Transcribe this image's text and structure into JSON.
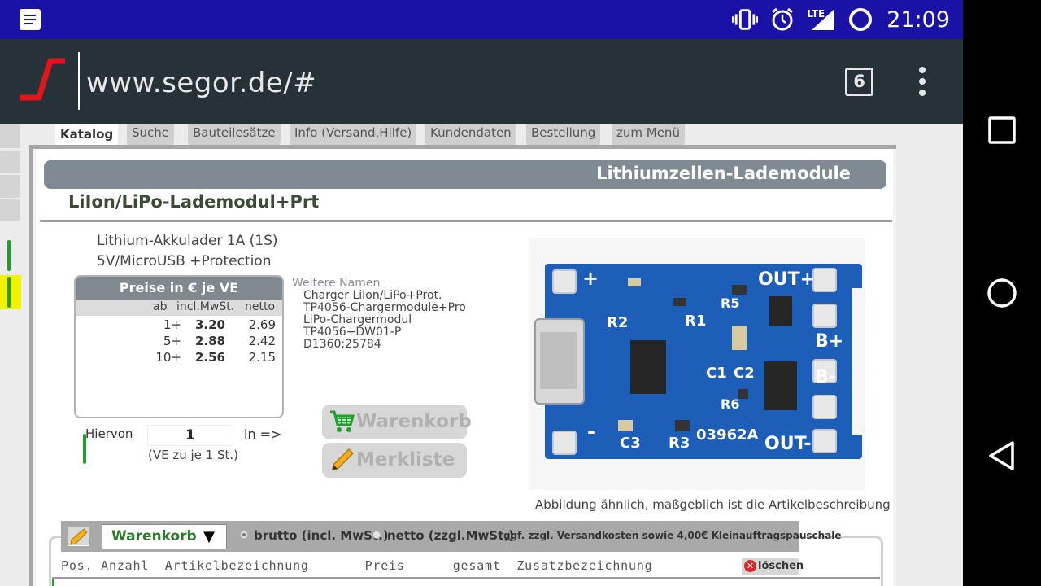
{
  "status_bar": {
    "time": "21:09",
    "network": "LTE"
  },
  "browser": {
    "url": "www.segor.de/#",
    "tab_count": "6"
  },
  "nav_tabs": [
    {
      "label": "Katalog",
      "active": true
    },
    {
      "label": "Suche"
    },
    {
      "label": "Bauteilesätze"
    },
    {
      "label": "Info (Versand,Hilfe)"
    },
    {
      "label": "Kundendaten"
    },
    {
      "label": "Bestellung"
    },
    {
      "label": "zum Menü"
    }
  ],
  "category": "Lithiumzellen-Lademodule",
  "product": {
    "title": "LiIon/LiPo-Lademodul+Prt",
    "desc_line1": "Lithium-Akkulader 1A (1S)",
    "desc_line2": "5V/MicroUSB +Protection"
  },
  "prices": {
    "header": "Preise in € je VE",
    "col_ab": "ab",
    "col_incl": "incl.MwSt.",
    "col_netto": "netto",
    "rows": [
      {
        "ab": "1+",
        "incl": "3.20",
        "netto": "2.69"
      },
      {
        "ab": "5+",
        "incl": "2.88",
        "netto": "2.42"
      },
      {
        "ab": "10+",
        "incl": "2.56",
        "netto": "2.15"
      }
    ]
  },
  "quantity": {
    "label": "Hiervon",
    "value": "1",
    "suffix": "in =>",
    "note": "(VE zu je 1 St.)"
  },
  "more_names": {
    "title": "Weitere Namen",
    "items": [
      "Charger LiIon/LiPo+Prot.",
      "TP4056-Chargermodule+Pro",
      "LiPo-Chargermodul",
      "TP4056+DW01-P",
      "D1360;25784"
    ]
  },
  "actions": {
    "cart": "Warenkorb",
    "watchlist": "Merkliste"
  },
  "image": {
    "caption": "Abbildung ähnlich, maßgeblich ist die Artikelbeschreibung",
    "board_labels": [
      "OUT+",
      "OUT-",
      "B+",
      "B-",
      "R2",
      "R1",
      "R3",
      "R5",
      "R6",
      "C1",
      "C2",
      "C3",
      "03962A",
      "+",
      "-"
    ]
  },
  "basket": {
    "select_value": "Warenkorb",
    "radio_brutto": "brutto (incl. MwSt.)",
    "radio_netto": "netto (zzgl.MwSt.)",
    "shipping_note": "ggf. zzgl. Versandkosten sowie 4,00€ Kleinauftragspauschale",
    "columns_text": "Pos. Anzahl  Artikelbezeichnung       Preis      gesamt  Zusatzbezeichnung",
    "delete_label": "löschen"
  },
  "colors": {
    "status_bar": "#1a12a6",
    "toolbar": "#263238",
    "category_bar": "#7f8a93",
    "accent_green": "#1ea12a",
    "logo_red": "#e3151b"
  }
}
